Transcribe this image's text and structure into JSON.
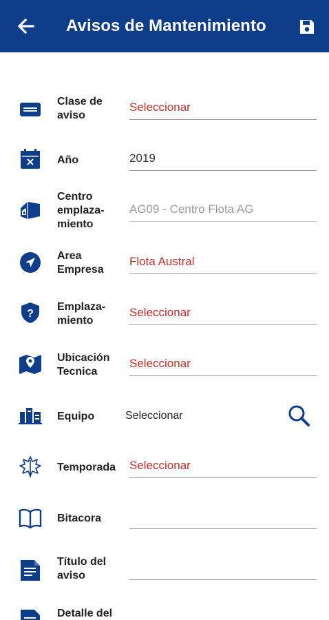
{
  "header": {
    "title": "Avisos de Mantenimiento",
    "back_icon": "arrow-left-icon",
    "save_icon": "save-icon"
  },
  "colors": {
    "primary": "#0e3d8a",
    "placeholder_red": "#c0302a",
    "disabled_grey": "#9a9a9a"
  },
  "form": {
    "clase": {
      "label": "Clase de\naviso",
      "value": "Seleccionar",
      "icon": "card-icon"
    },
    "anio": {
      "label": "Año",
      "value": "2019",
      "icon": "calendar-icon"
    },
    "centro": {
      "label": "Centro\nemplaza-\nmiento",
      "value": "AG09 - Centro Flota AG",
      "icon": "house-icon"
    },
    "area": {
      "label": "Area\nEmpresa",
      "value": "Flota Austral",
      "icon": "navigation-icon"
    },
    "emplazamiento": {
      "label": "Emplaza-\nmiento",
      "value": "Seleccionar",
      "icon": "shield-question-icon"
    },
    "ubicacion": {
      "label": "Ubicación\nTecnica",
      "value": "Seleccionar",
      "icon": "map-pin-icon"
    },
    "equipo": {
      "label": "Equipo",
      "value": "Seleccionar",
      "icon": "equipment-icon",
      "search_icon": "search-icon"
    },
    "temporada": {
      "label": "Temporada",
      "value": "Seleccionar",
      "icon": "leaf-icon"
    },
    "bitacora": {
      "label": "Bitacora",
      "value": "",
      "icon": "book-icon"
    },
    "titulo": {
      "label": "Título del\naviso",
      "value": "",
      "icon": "document-icon"
    },
    "detalle": {
      "label": "Detalle del",
      "icon": "document-icon"
    }
  }
}
